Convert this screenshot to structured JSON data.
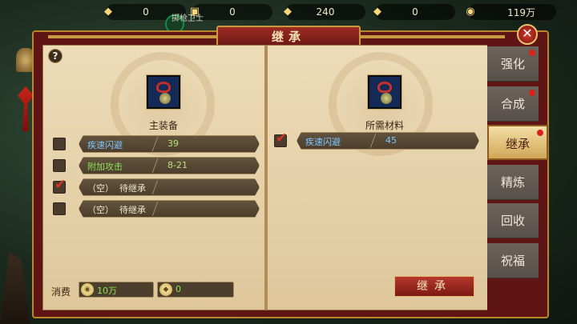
{
  "resources": [
    {
      "icon": "gold-ingot-icon",
      "value": "0"
    },
    {
      "icon": "ticket-icon",
      "value": "0"
    },
    {
      "icon": "silver-ingot-icon",
      "value": "240"
    },
    {
      "icon": "gold-ingot-bound-icon",
      "value": "0"
    },
    {
      "icon": "coin-icon",
      "value": "119万"
    }
  ],
  "player_tag": "掷枪卫士",
  "window": {
    "title": "继承"
  },
  "left": {
    "main_label": "主装备",
    "rows": [
      {
        "checked": false,
        "name": "疾速闪避",
        "value": "39",
        "name_color": "blue"
      },
      {
        "checked": false,
        "name": "附加攻击",
        "value": "8-21",
        "name_color": "green"
      },
      {
        "checked": true,
        "name": "（空）",
        "pending": "待继承"
      },
      {
        "checked": false,
        "name": "（空）",
        "pending": "待继承"
      }
    ]
  },
  "right": {
    "material_label": "所需材料",
    "rows": [
      {
        "checked": true,
        "name": "疾速闪避",
        "value": "45",
        "name_color": "blue"
      }
    ]
  },
  "cost": {
    "label": "消费",
    "coin_value": "10万",
    "ingot_value": "0"
  },
  "action_button": "继承",
  "tabs": [
    {
      "label": "强化",
      "dot": true
    },
    {
      "label": "合成",
      "dot": true
    },
    {
      "label": "继承",
      "dot": true,
      "active": true
    },
    {
      "label": "精炼",
      "dot": false
    },
    {
      "label": "回收",
      "dot": false
    },
    {
      "label": "祝福",
      "dot": false
    }
  ],
  "help": "?",
  "close": "✕"
}
